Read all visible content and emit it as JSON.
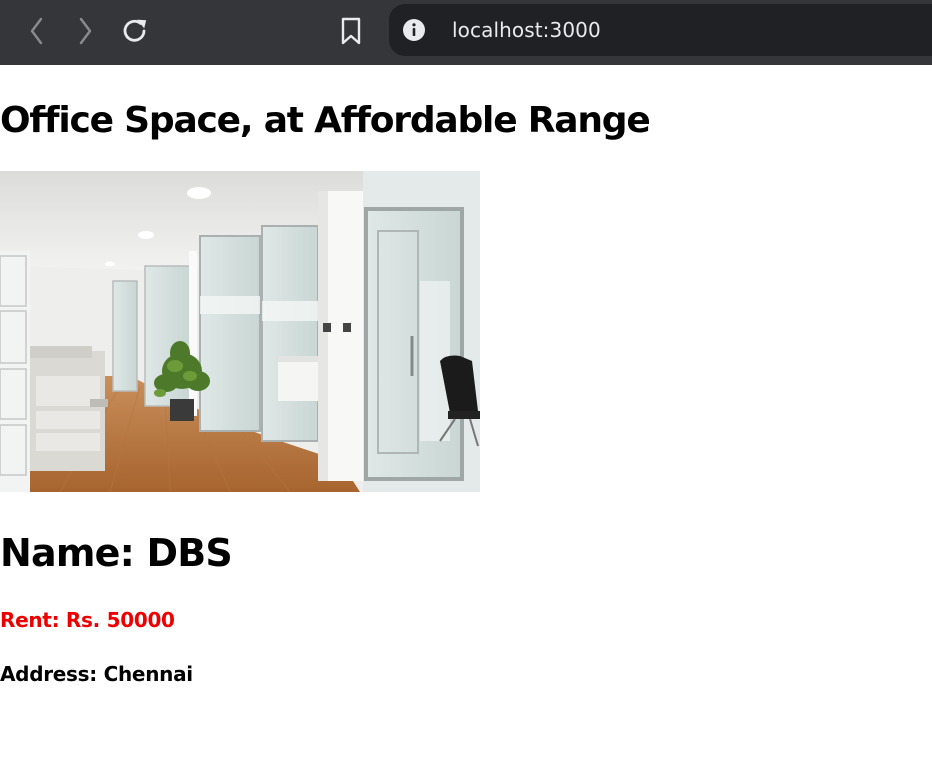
{
  "browser": {
    "url": "localhost:3000",
    "icons": {
      "back": "chevron-left-icon",
      "forward": "chevron-right-icon",
      "reload": "reload-icon",
      "bookmark": "bookmark-icon",
      "site_info": "info-icon"
    },
    "colors": {
      "toolbar": "#35363a",
      "omnibox": "#202124",
      "url_text": "#e8eaed"
    }
  },
  "page": {
    "title": "Office Space, at Affordable Range",
    "image": {
      "kind": "photo",
      "subject": "office-interior"
    },
    "listing": {
      "name_prefix": "Name: ",
      "name": "DBS",
      "rent_prefix": "Rent: Rs. ",
      "rent": "50000",
      "address_prefix": "Address: ",
      "address": "Chennai"
    },
    "colors": {
      "rent_text": "#ee0000",
      "text": "#000000",
      "background": "#ffffff"
    }
  }
}
